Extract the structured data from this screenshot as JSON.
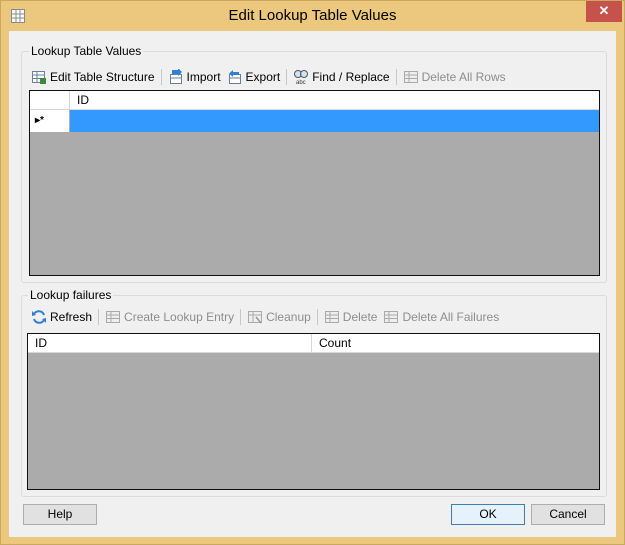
{
  "window": {
    "title": "Edit Lookup Table Values",
    "close_glyph": "✕"
  },
  "lookup_values": {
    "group_title": "Lookup Table Values",
    "toolbar": {
      "edit_structure": "Edit Table Structure",
      "import": "Import",
      "export": "Export",
      "find_replace": "Find / Replace",
      "delete_all_rows": "Delete All Rows"
    },
    "columns": [
      "ID"
    ],
    "new_row_marker": "▸*"
  },
  "lookup_failures": {
    "group_title": "Lookup failures",
    "toolbar": {
      "refresh": "Refresh",
      "create_entry": "Create Lookup Entry",
      "cleanup": "Cleanup",
      "delete": "Delete",
      "delete_all": "Delete All Failures"
    },
    "columns": [
      "ID",
      "Count"
    ]
  },
  "buttons": {
    "help": "Help",
    "ok": "OK",
    "cancel": "Cancel"
  },
  "colors": {
    "frame": "#ebc87d",
    "close": "#c7514b",
    "selection": "#3399ff",
    "grid_bg": "#ababab"
  },
  "icons": [
    "table-icon",
    "edit-structure-icon",
    "import-icon",
    "export-icon",
    "find-replace-icon",
    "delete-rows-icon",
    "refresh-icon",
    "create-entry-icon",
    "cleanup-icon",
    "delete-icon",
    "delete-all-icon"
  ]
}
